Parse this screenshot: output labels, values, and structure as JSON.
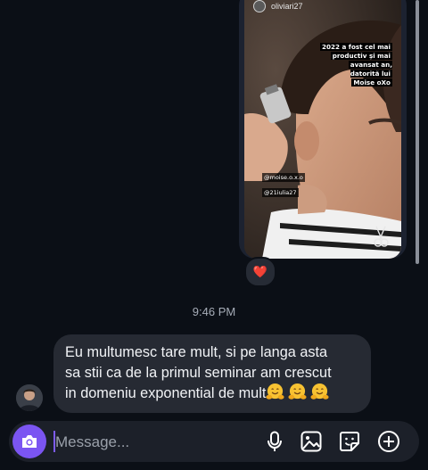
{
  "story": {
    "username": "oliviari27",
    "caption_lines": [
      "2022 a fost cel mai",
      "productiv și mai",
      "avansat an, datorită lui",
      "Moise oXo"
    ],
    "tags": [
      "@moise.o.x.o",
      "@21iulia27"
    ]
  },
  "reaction": {
    "emoji": "❤️"
  },
  "timestamp": "9:46 PM",
  "message": {
    "lines": [
      "Eu multumesc tare mult, si pe langa asta",
      "sa stii ca de la primul seminar am crescut",
      "in domeniu exponential de mult"
    ]
  },
  "composer": {
    "placeholder": "Message...",
    "icons": [
      "camera-icon",
      "microphone-icon",
      "gallery-icon",
      "sticker-icon",
      "plus-icon"
    ]
  },
  "colors": {
    "background": "#0b0f16",
    "bubble": "#262a33",
    "composer": "#1c2029",
    "camera_button": "#7b55f2",
    "heart": "#ff3040"
  }
}
